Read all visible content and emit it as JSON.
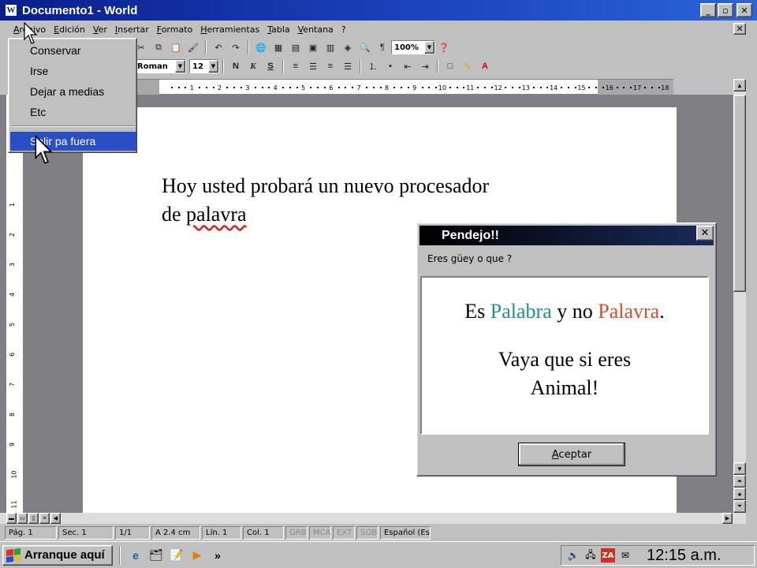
{
  "window": {
    "title": "Documento1 - World",
    "controls": {
      "minimize": "_",
      "maximize": "▫",
      "close": "✕"
    }
  },
  "menubar": {
    "items": [
      "Archivo",
      "Edición",
      "Ver",
      "Insertar",
      "Formato",
      "Herramientas",
      "Tabla",
      "Ventana",
      "?"
    ],
    "doc_close": "✕"
  },
  "file_menu": {
    "items": [
      "Conservar",
      "Irse",
      "Dejar a medias",
      "Etc",
      "Salir pa fuera"
    ],
    "highlighted": "Salir pa fuera"
  },
  "toolbar": {
    "zoom": "100%",
    "font": "Roman",
    "size": "12",
    "bold": "N",
    "italic": "K",
    "underline": "S"
  },
  "ruler": {
    "numbers": [
      "1",
      "2",
      "3",
      "4",
      "5",
      "6",
      "7",
      "8",
      "9",
      "10",
      "11",
      "12",
      "13",
      "14",
      "15",
      "16",
      "17",
      "18"
    ]
  },
  "vruler": {
    "numbers": [
      "1",
      "2",
      "3",
      "4",
      "5",
      "6",
      "7",
      "8",
      "9",
      "10",
      "11"
    ]
  },
  "document": {
    "line1": "Hoy usted probará un nuevo procesador",
    "line2_prefix": "de ",
    "misspelled": "palavra"
  },
  "dialog": {
    "title": "Pendejo!!",
    "close": "✕",
    "message": "Eres güey o que ?",
    "line1_a": "Es ",
    "line1_b": "Palabra",
    "line1_c": " y no ",
    "line1_d": "Palavra",
    "line1_e": ".",
    "line2a": "Vaya que si eres",
    "line2b": "Animal!",
    "ok": "Aceptar",
    "colors": {
      "correct": "#1f8f8f",
      "wrong": "#e04a2a"
    }
  },
  "status": {
    "page": "Pág. 1",
    "section": "Sec. 1",
    "pages": "1/1",
    "at": "A 2.4 cm",
    "line": "Lín. 1",
    "col": "Col. 1",
    "grb": "GRB",
    "mca": "MCA",
    "ext": "EXT",
    "sob": "SOB",
    "language": "Español (Es"
  },
  "taskbar": {
    "start": "Arranque aquí",
    "more": "»",
    "clock": "12:15 a.m."
  },
  "icons": [
    "app-icon",
    "ie-icon",
    "explorer-icon",
    "notepad-icon",
    "media-icon",
    "speaker-icon",
    "network-icon",
    "zonealarm-icon",
    "mail-icon"
  ],
  "colors": {
    "titlebar": "#0a1e8c",
    "highlight": "#2a4fc4",
    "spellcheck": "#e02020"
  }
}
